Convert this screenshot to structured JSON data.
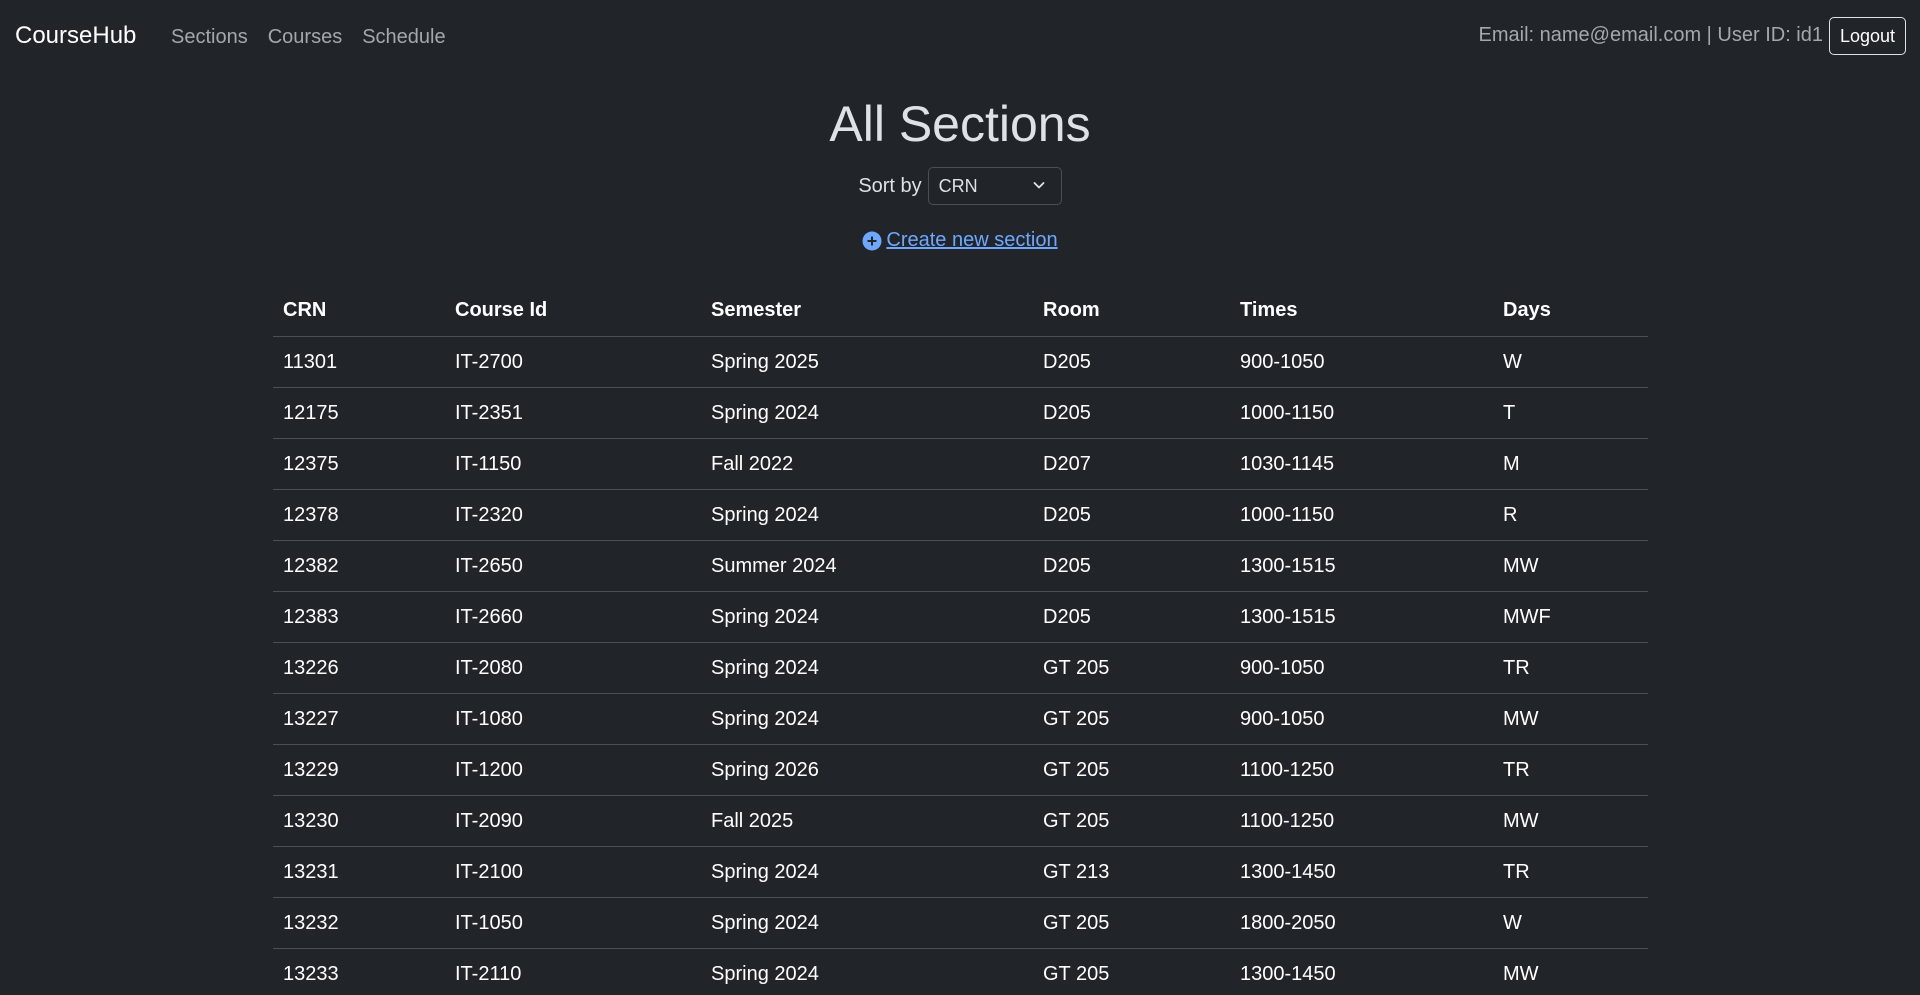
{
  "navbar": {
    "brand": "CourseHub",
    "links": [
      "Sections",
      "Courses",
      "Schedule"
    ],
    "user_info": "Email: name@email.com | User ID: id1",
    "logout_label": "Logout"
  },
  "main": {
    "title": "All Sections",
    "sort_label": "Sort by",
    "sort_value": "CRN",
    "create_link": "Create new section"
  },
  "table": {
    "headers": [
      "CRN",
      "Course Id",
      "Semester",
      "Room",
      "Times",
      "Days"
    ],
    "rows": [
      [
        "11301",
        "IT-2700",
        "Spring 2025",
        "D205",
        "900-1050",
        "W"
      ],
      [
        "12175",
        "IT-2351",
        "Spring 2024",
        "D205",
        "1000-1150",
        "T"
      ],
      [
        "12375",
        "IT-1150",
        "Fall 2022",
        "D207",
        "1030-1145",
        "M"
      ],
      [
        "12378",
        "IT-2320",
        "Spring 2024",
        "D205",
        "1000-1150",
        "R"
      ],
      [
        "12382",
        "IT-2650",
        "Summer 2024",
        "D205",
        "1300-1515",
        "MW"
      ],
      [
        "12383",
        "IT-2660",
        "Spring 2024",
        "D205",
        "1300-1515",
        "MWF"
      ],
      [
        "13226",
        "IT-2080",
        "Spring 2024",
        "GT 205",
        "900-1050",
        "TR"
      ],
      [
        "13227",
        "IT-1080",
        "Spring 2024",
        "GT 205",
        "900-1050",
        "MW"
      ],
      [
        "13229",
        "IT-1200",
        "Spring 2026",
        "GT 205",
        "1100-1250",
        "TR"
      ],
      [
        "13230",
        "IT-2090",
        "Fall 2025",
        "GT 205",
        "1100-1250",
        "MW"
      ],
      [
        "13231",
        "IT-2100",
        "Spring 2024",
        "GT 213",
        "1300-1450",
        "TR"
      ],
      [
        "13232",
        "IT-1050",
        "Spring 2024",
        "GT 205",
        "1800-2050",
        "W"
      ],
      [
        "13233",
        "IT-2110",
        "Spring 2024",
        "GT 205",
        "1300-1450",
        "MW"
      ]
    ]
  },
  "colors": {
    "background": "#212529",
    "link": "#6ea8fe",
    "muted_nav": "#a3a8ad",
    "border": "#495057"
  }
}
